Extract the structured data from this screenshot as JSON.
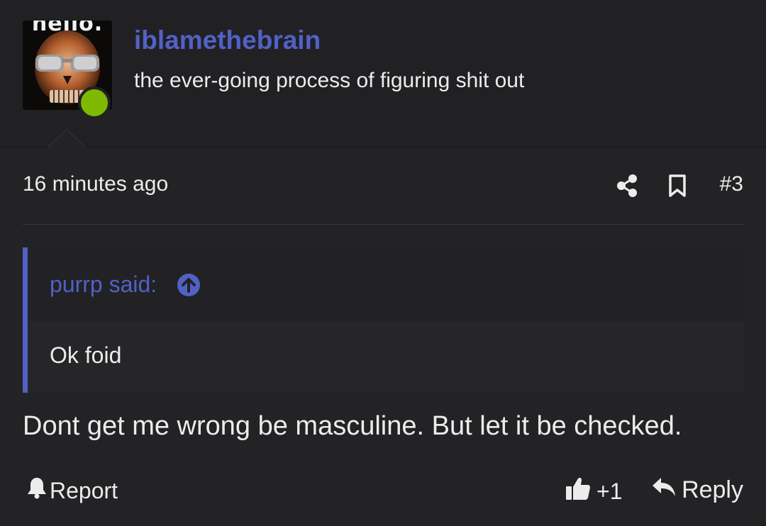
{
  "user": {
    "avatar_text": "hello.",
    "username": "iblamethebrain",
    "custom_title": "the ever-going process of figuring shit out",
    "online_color": "#7fb800"
  },
  "post": {
    "timestamp": "16 minutes ago",
    "number": "#3",
    "quote": {
      "author_label": "purrp said:",
      "text": "Ok foid"
    },
    "message": "Dont get me wrong be masculine. But let it be checked."
  },
  "actions": {
    "report_label": "Report",
    "reaction_count": "+1",
    "reply_label": "Reply"
  },
  "icons": {
    "share": "share-icon",
    "bookmark": "bookmark-icon",
    "quote_jump": "arrow-up-circle-icon",
    "report": "bell-icon",
    "like": "thumbs-up-icon",
    "reply": "reply-arrow-icon"
  },
  "colors": {
    "background": "#232325",
    "accent": "#5161c6",
    "text": "#ececec"
  }
}
